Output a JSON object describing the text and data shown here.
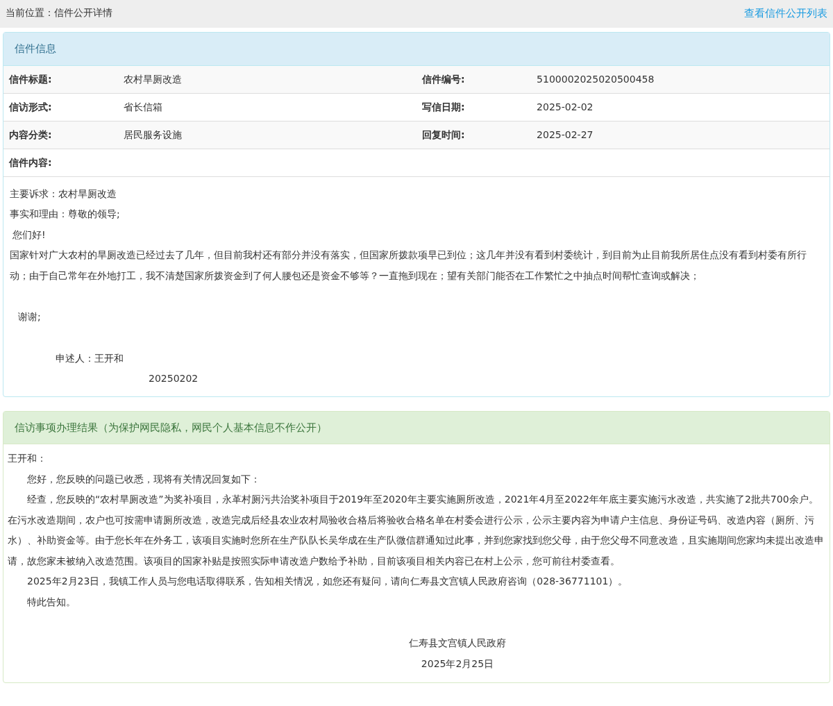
{
  "breadcrumb": {
    "text": "当前位置：信件公开详情",
    "link": "查看信件公开列表"
  },
  "letter_info": {
    "title": "信件信息",
    "rows": [
      {
        "cells": [
          {
            "label": "信件标题:",
            "value": "农村旱厕改造"
          },
          {
            "label": "信件编号:",
            "value": "5100002025020500458"
          }
        ]
      },
      {
        "cells": [
          {
            "label": "信访形式:",
            "value": "省长信箱"
          },
          {
            "label": "写信日期:",
            "value": "2025-02-02"
          }
        ]
      },
      {
        "cells": [
          {
            "label": "内容分类:",
            "value": "居民服务设施"
          },
          {
            "label": "回复时间:",
            "value": "2025-02-27"
          }
        ]
      },
      {
        "cells": [
          {
            "label": "信件内容:"
          }
        ]
      }
    ],
    "content": [
      {
        "kind": "line",
        "text": "主要诉求：农村旱厕改造"
      },
      {
        "kind": "line",
        "text": "事实和理由：尊敬的领导;"
      },
      {
        "kind": "greeting",
        "text": "您们好!"
      },
      {
        "kind": "line",
        "text": "国家针对广大农村的旱厕改造已经过去了几年，但目前我村还有部分并没有落实，但国家所拨款项早已到位；这几年并没有看到村委统计，到目前为止目前我所居住点没有看到村委有所行动；由于自己常年在外地打工，我不清楚国家所拨资金到了何人腰包还是资金不够等？一直拖到现在；望有关部门能否在工作繁忙之中抽点时间帮忙查询或解决；"
      },
      {
        "kind": "thanks",
        "text": "谢谢;"
      },
      {
        "kind": "signer",
        "text": "申述人：王开和"
      },
      {
        "kind": "signdate",
        "text": "20250202"
      }
    ]
  },
  "result": {
    "title": "信访事项办理结果（为保护网民隐私，网民个人基本信息不作公开）",
    "content": [
      {
        "kind": "salutation",
        "text": "王开和："
      },
      {
        "kind": "paragraph",
        "text": "您好，您反映的问题已收悉，现将有关情况回复如下："
      },
      {
        "kind": "paragraph",
        "text": "经查，您反映的“农村旱厕改造”为奖补项目，永革村厕污共治奖补项目于2019年至2020年主要实施厕所改造，2021年4月至2022年年底主要实施污水改造，共实施了2批共700余户。在污水改造期间，农户也可按需申请厕所改造，改造完成后经县农业农村局验收合格后将验收合格名单在村委会进行公示，公示主要内容为申请户主信息、身份证号码、改造内容（厕所、污水）、补助资金等。由于您长年在外务工，该项目实施时您所在生产队队长吴华成在生产队微信群通知过此事，并到您家找到您父母，由于您父母不同意改造，且实施期间您家均未提出改造申请，故您家未被纳入改造范围。该项目的国家补贴是按照实际申请改造户数给予补助，目前该项目相关内容已在村上公示，您可前往村委查看。"
      },
      {
        "kind": "paragraph",
        "text": "2025年2月23日，我镇工作人员与您电话取得联系，告知相关情况，如您还有疑问，请向仁寿县文宫镇人民政府咨询（028-36771101）。"
      },
      {
        "kind": "paragraph",
        "text": "特此告知。"
      },
      {
        "kind": "signer",
        "text": "仁寿县文宫镇人民政府"
      },
      {
        "kind": "signdate",
        "text": "2025年2月25日"
      }
    ]
  }
}
